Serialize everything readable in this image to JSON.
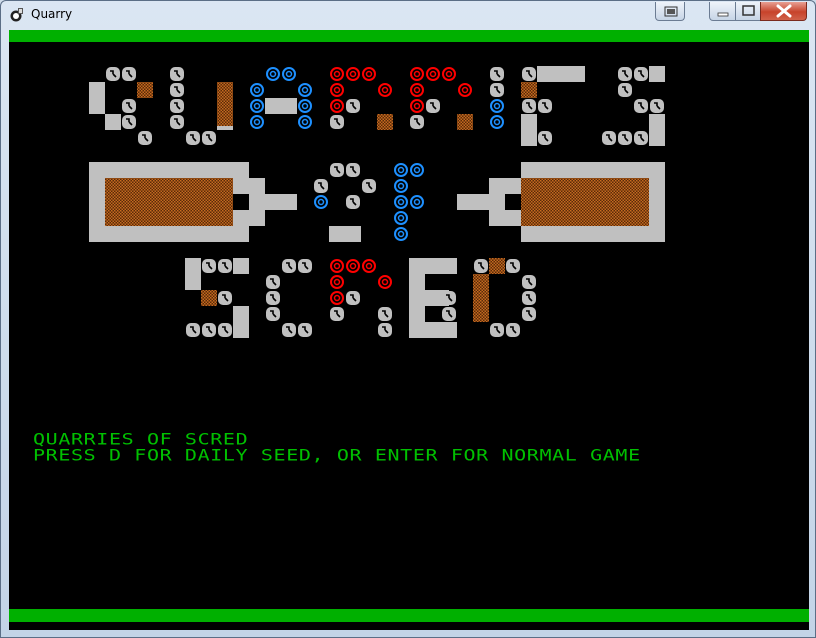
{
  "window": {
    "title": "Quarry",
    "app_icon": "quarry-app-icon",
    "controls": [
      "snap-icon",
      "minimize-icon",
      "maximize-icon",
      "close-icon"
    ]
  },
  "game": {
    "logo_text": "QUARRIES OF SCRED",
    "title_line": "QUARRIES OF SCRED",
    "prompt_line": "PRESS D FOR DAILY SEED, OR ENTER FOR NORMAL GAME",
    "colors": {
      "background": "#000000",
      "border": "#00b000",
      "text": "#00c000",
      "stone": "#c0c0c0",
      "ore": "#8b4513",
      "water": "#1e90ff",
      "lava": "#ff0000"
    }
  }
}
